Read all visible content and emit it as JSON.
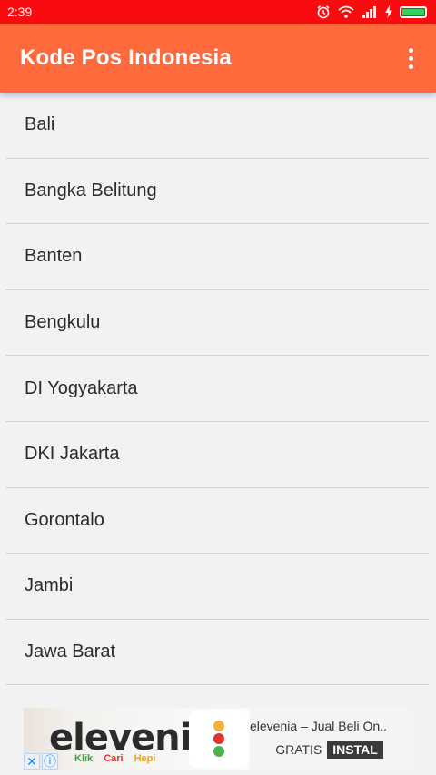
{
  "status_bar": {
    "time": "2:39"
  },
  "app_bar": {
    "title": "Kode Pos Indonesia"
  },
  "provinces": [
    "Bali",
    "Bangka Belitung",
    "Banten",
    "Bengkulu",
    "DI Yogyakarta",
    "DKI Jakarta",
    "Gorontalo",
    "Jambi",
    "Jawa Barat"
  ],
  "ad": {
    "brand": "elevenia",
    "tagline": [
      "Klik",
      "Cari",
      "Hepi"
    ],
    "headline": "elevenia – Jual Beli On..",
    "cta_prefix": "GRATIS",
    "cta_button": "INSTAL",
    "close_symbol": "✕",
    "info_symbol": "ⓘ"
  },
  "colors": {
    "status_bar": "#f80c0f",
    "app_bar": "#fe6a3c",
    "background": "#f2f2f2"
  }
}
